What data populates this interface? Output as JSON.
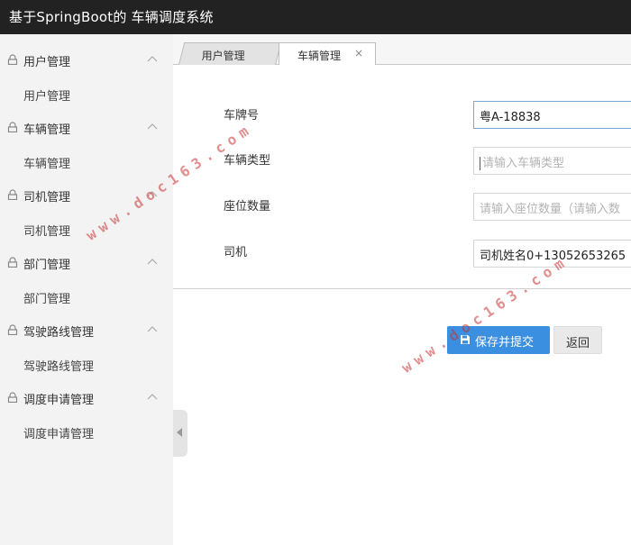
{
  "header": {
    "title": "基于SpringBoot的 车辆调度系统"
  },
  "sidebar": {
    "groups": [
      {
        "label": "用户管理",
        "item": "用户管理"
      },
      {
        "label": "车辆管理",
        "item": "车辆管理"
      },
      {
        "label": "司机管理",
        "item": "司机管理"
      },
      {
        "label": "部门管理",
        "item": "部门管理"
      },
      {
        "label": "驾驶路线管理",
        "item": "驾驶路线管理"
      },
      {
        "label": "调度申请管理",
        "item": "调度申请管理"
      }
    ]
  },
  "tabs": [
    {
      "label": "用户管理"
    },
    {
      "label": "车辆管理",
      "close": "×"
    }
  ],
  "form": {
    "fields": [
      {
        "label": "车牌号",
        "value": "粤A-18838"
      },
      {
        "label": "车辆类型",
        "placeholder": "请输入车辆类型"
      },
      {
        "label": "座位数量",
        "placeholder": "请输入座位数量（请输入数"
      },
      {
        "label": "司机",
        "value": "司机姓名0+13052653265"
      }
    ]
  },
  "buttons": {
    "save": "保存并提交",
    "back": "返回"
  },
  "watermark": "www.doc163.com",
  "colors": {
    "topbar": "#222222",
    "sidebar": "#f3f3f3",
    "primary": "#3b8fe0",
    "watermark": "#c83232"
  }
}
